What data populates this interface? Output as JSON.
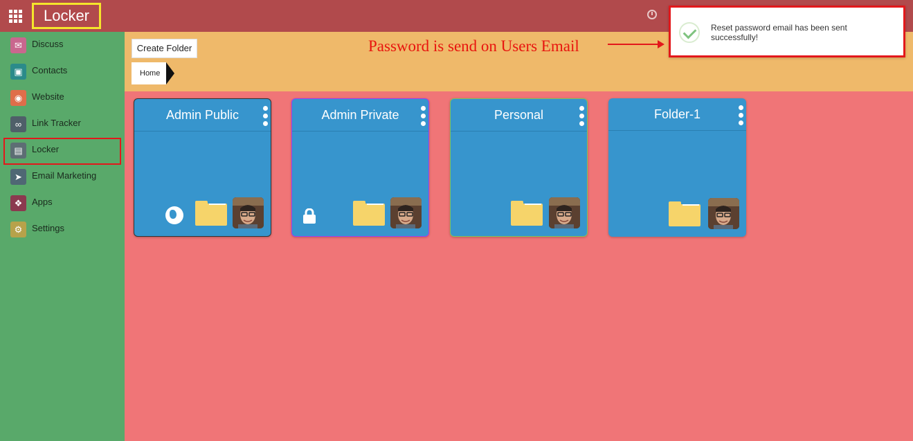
{
  "header": {
    "app_title": "Locker",
    "colors": {
      "topbar": "#b14a4c",
      "title_highlight": "#f5e52b"
    }
  },
  "sidebar": {
    "items": [
      {
        "label": "Discuss",
        "icon": "discuss-icon",
        "color": "#c9678e"
      },
      {
        "label": "Contacts",
        "icon": "contacts-icon",
        "color": "#2b8b8a"
      },
      {
        "label": "Website",
        "icon": "website-icon",
        "color": "#df6e4a"
      },
      {
        "label": "Link Tracker",
        "icon": "link-icon",
        "color": "#4f5f69"
      },
      {
        "label": "Locker",
        "icon": "locker-icon",
        "color": "#5d6e74",
        "highlighted": true
      },
      {
        "label": "Email Marketing",
        "icon": "paper-plane-icon",
        "color": "#4f6774"
      },
      {
        "label": "Apps",
        "icon": "apps-icon",
        "color": "#8b3a4f"
      },
      {
        "label": "Settings",
        "icon": "gear-icon",
        "color": "#b7a24a"
      }
    ]
  },
  "controls": {
    "create_folder_label": "Create Folder",
    "breadcrumb": "Home"
  },
  "annotation": {
    "text": "Password is send on Users Email"
  },
  "toast": {
    "message": "Reset password email has been sent successfully!",
    "icon": "checkmark-icon"
  },
  "folders": [
    {
      "title": "Admin Public",
      "badge": "globe-icon",
      "border": "#333333"
    },
    {
      "title": "Admin Private",
      "badge": "lock-icon",
      "border": "#9b40f0"
    },
    {
      "title": "Personal",
      "badge": "",
      "border": "#7fc45b"
    },
    {
      "title": "Folder-1",
      "badge": "",
      "border": "#3795cd"
    }
  ]
}
